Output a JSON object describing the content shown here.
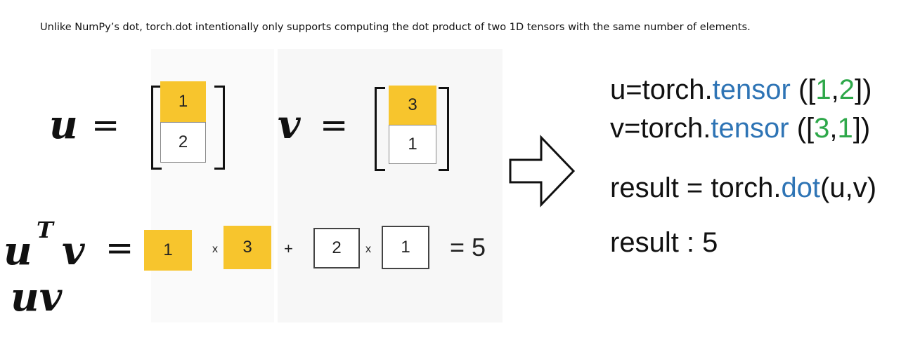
{
  "caption": "Unlike NumPy’s dot, torch.dot intentionally only supports computing the dot product of two 1D tensors with the same number of elements.",
  "math": {
    "u_label": "u",
    "v_label": "v",
    "equals": "=",
    "u_values": [
      "1",
      "2"
    ],
    "v_values": [
      "3",
      "1"
    ],
    "ut_label": "u",
    "ut_superscript": "T",
    "ut_v_label": "v",
    "uv_label": "uv",
    "product_terms": [
      "1",
      "3",
      "2",
      "1"
    ],
    "times": "x",
    "plus": "+",
    "result": "= 5"
  },
  "code": {
    "line1": {
      "prefix": "u=torch.",
      "method": "tensor",
      "open": " ([",
      "a": "1",
      "comma": ",",
      "b": "2",
      "close": "])"
    },
    "line2": {
      "prefix": "v=torch.",
      "method": "tensor",
      "open": " ([",
      "a": "3",
      "comma": ",",
      "b": "1",
      "close": "])"
    },
    "line3": {
      "prefix": "result = torch.",
      "method": "dot",
      "suffix": "(u,v)"
    },
    "line4": "result : 5"
  },
  "colors": {
    "highlight": "#f7c52d",
    "method": "#2e74b5",
    "number": "#2ea84a"
  },
  "icons": {
    "arrow": "right-arrow-outline-icon"
  }
}
